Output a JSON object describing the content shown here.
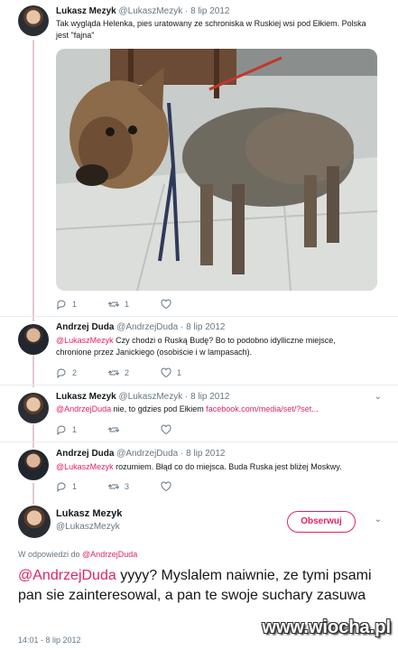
{
  "tweets": [
    {
      "name": "Lukasz Mezyk",
      "handle": "@LukaszMezyk",
      "dot_date": "· 8 lip 2012",
      "text": "Tak wygląda Helenka, pies uratowany ze schroniska w Ruskiej wsi pod Ełkiem. Polska jest \"fajna\"",
      "replies": "1",
      "retweets": "1",
      "likes": ""
    },
    {
      "name": "Andrzej Duda",
      "handle": "@AndrzejDuda",
      "dot_date": "· 8 lip 2012",
      "mention": "@LukaszMezyk",
      "text": " Czy chodzi o Ruską Budę? Bo to podobno idylliczne miejsce, chronione przez Janickiego (osobiście i w lampasach).",
      "replies": "2",
      "retweets": "2",
      "likes": "1"
    },
    {
      "name": "Lukasz Mezyk",
      "handle": "@LukaszMezyk",
      "dot_date": "· 8 lip 2012",
      "mention": "@AndrzejDuda",
      "text": " nie, to gdzies pod Ełkiem ",
      "link": "facebook.com/media/set/?set...",
      "replies": "1",
      "retweets": "",
      "likes": ""
    },
    {
      "name": "Andrzej Duda",
      "handle": "@AndrzejDuda",
      "dot_date": "· 8 lip 2012",
      "mention": "@LukaszMezyk",
      "text": " rozumiem. Błąd co do miejsca. Buda Ruska jest bliżej Moskwy.",
      "replies": "1",
      "retweets": "3",
      "likes": ""
    }
  ],
  "main": {
    "name": "Lukasz Mezyk",
    "handle": "@LukaszMezyk",
    "follow_label": "Obserwuj",
    "reply_prefix": "W odpowiedzi do ",
    "reply_mention": "@AndrzejDuda",
    "mention": "@AndrzejDuda",
    "text": " yyyy? Myslalem naiwnie, ze tymi psami pan sie zainteresowal, a pan te swoje suchary zasuwa",
    "timestamp": "14:01 - 8 lip 2012"
  },
  "watermark": "www.wiocha.pl",
  "colors": {
    "accent": "#e0245e",
    "secondary": "#657786",
    "thread": "#e6c8d2"
  }
}
